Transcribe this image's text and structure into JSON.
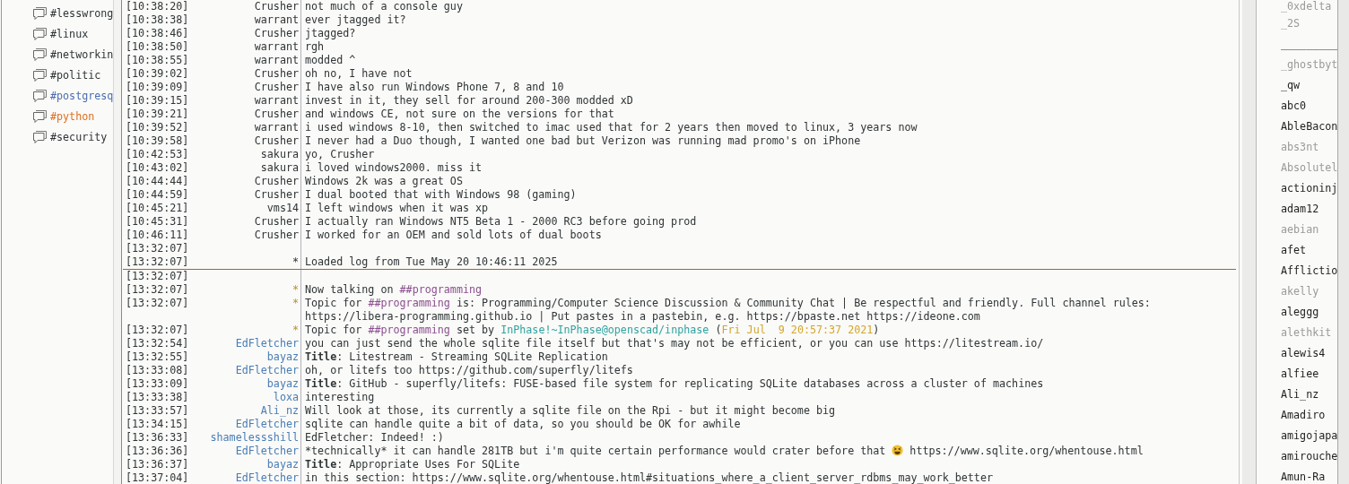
{
  "channels": [
    {
      "name": "#lesswrong",
      "unread": false,
      "highlighted": false
    },
    {
      "name": "#linux",
      "unread": false,
      "highlighted": false
    },
    {
      "name": "#networkin",
      "unread": false,
      "highlighted": false
    },
    {
      "name": "#politic",
      "unread": false,
      "highlighted": false
    },
    {
      "name": "#postgresq",
      "unread": true,
      "highlighted": false
    },
    {
      "name": "#python",
      "unread": false,
      "highlighted": true
    },
    {
      "name": "#security",
      "unread": false,
      "highlighted": false
    }
  ],
  "lines": [
    {
      "kind": "message",
      "time": "[10:38:20]",
      "nick": "Crusher",
      "color": "#2e3436",
      "text": "not much of a console guy"
    },
    {
      "kind": "message",
      "time": "[10:38:38]",
      "nick": "warrant",
      "color": "#2e3436",
      "text": "ever jtagged it?"
    },
    {
      "kind": "message",
      "time": "[10:38:46]",
      "nick": "Crusher",
      "color": "#2e3436",
      "text": "jtagged?"
    },
    {
      "kind": "message",
      "time": "[10:38:50]",
      "nick": "warrant",
      "color": "#2e3436",
      "text": "rgh"
    },
    {
      "kind": "message",
      "time": "[10:38:55]",
      "nick": "warrant",
      "color": "#2e3436",
      "text": "modded ^"
    },
    {
      "kind": "message",
      "time": "[10:39:02]",
      "nick": "Crusher",
      "color": "#2e3436",
      "text": "oh no, I have not"
    },
    {
      "kind": "message",
      "time": "[10:39:09]",
      "nick": "Crusher",
      "color": "#2e3436",
      "text": "I have also run Windows Phone 7, 8 and 10"
    },
    {
      "kind": "message",
      "time": "[10:39:15]",
      "nick": "warrant",
      "color": "#2e3436",
      "text": "invest in it, they sell for around 200-300 modded xD"
    },
    {
      "kind": "message",
      "time": "[10:39:21]",
      "nick": "Crusher",
      "color": "#2e3436",
      "text": "and windows CE, not sure on the versions for that"
    },
    {
      "kind": "message",
      "time": "[10:39:52]",
      "nick": "warrant",
      "color": "#2e3436",
      "text": "i used windows 8-10, then switched to imac used that for 2 years then moved to linux, 3 years now"
    },
    {
      "kind": "message",
      "time": "[10:39:58]",
      "nick": "Crusher",
      "color": "#2e3436",
      "text": "I never had a Duo though, I wanted one bad but Verizon was running mad promo's on iPhone"
    },
    {
      "kind": "message",
      "time": "[10:42:53]",
      "nick": "sakura",
      "color": "#2e3436",
      "text": "yo, Crusher"
    },
    {
      "kind": "message",
      "time": "[10:43:02]",
      "nick": "sakura",
      "color": "#2e3436",
      "text": "i loved windows2000. miss it"
    },
    {
      "kind": "message",
      "time": "[10:44:44]",
      "nick": "Crusher",
      "color": "#2e3436",
      "text": "Windows 2k was a great OS"
    },
    {
      "kind": "message",
      "time": "[10:44:59]",
      "nick": "Crusher",
      "color": "#2e3436",
      "text": "I dual booted that with Windows 98 (gaming)"
    },
    {
      "kind": "message",
      "time": "[10:45:21]",
      "nick": "vms14",
      "color": "#2e3436",
      "text": "I left windows when it was xp"
    },
    {
      "kind": "message",
      "time": "[10:45:31]",
      "nick": "Crusher",
      "color": "#2e3436",
      "text": "I actually ran Windows NT5 Beta 1 - 2000 RC3 before going prod"
    },
    {
      "kind": "message",
      "time": "[10:46:11]",
      "nick": "Crusher",
      "color": "#2e3436",
      "text": "I worked for an OEM and sold lots of dual boots"
    },
    {
      "kind": "message",
      "time": "[13:32:07]"
    },
    {
      "kind": "notice",
      "time": "[13:32:07]",
      "nick": "*",
      "text": "Loaded log from Tue May 20 10:46:11 2025"
    },
    {
      "kind": "marker"
    },
    {
      "kind": "message",
      "time": "[13:32:07]"
    },
    {
      "kind": "event",
      "time": "[13:32:07]",
      "nick": "*",
      "parts": [
        {
          "kind": "plain",
          "text": "Now talking on "
        },
        {
          "kind": "channel",
          "text": "##programming"
        }
      ]
    },
    {
      "kind": "event",
      "time": "[13:32:07]",
      "nick": "*",
      "parts": [
        {
          "kind": "plain",
          "text": "Topic for "
        },
        {
          "kind": "channel",
          "text": "##programming"
        },
        {
          "kind": "plain",
          "text": " is: Programming/Computer Science Discussion & Community Chat | Be respectful and friendly. Full channel rules: https://libera-programming.github.io | Put pastes in a pastebin, e.g. https://bpaste.net https://ideone.com"
        }
      ]
    },
    {
      "kind": "event",
      "time": "[13:32:07]",
      "nick": "*",
      "parts": [
        {
          "kind": "plain",
          "text": "Topic for "
        },
        {
          "kind": "channel",
          "text": "##programming"
        },
        {
          "kind": "plain",
          "text": " set by "
        },
        {
          "kind": "host",
          "text": "InPhase!~InPhase@openscad/inphase"
        },
        {
          "kind": "plain",
          "text": " ("
        },
        {
          "kind": "date",
          "text": "Fri Jul  9 20:57:37 2021"
        },
        {
          "kind": "plain",
          "text": ")"
        }
      ]
    },
    {
      "kind": "message",
      "time": "[13:32:54]",
      "nick": "EdFletcher",
      "color": "#4a7db5",
      "text": "you can just send the whole sqlite file itself but that's may not be efficient, or you can use https://litestream.io/"
    },
    {
      "kind": "message",
      "time": "[13:32:55]",
      "nick": "bayaz",
      "color": "#4a7db5",
      "text": "**Title**: Litestream - Streaming SQLite Replication"
    },
    {
      "kind": "message",
      "time": "[13:33:08]",
      "nick": "EdFletcher",
      "color": "#4a7db5",
      "text": "oh, or litefs too https://github.com/superfly/litefs"
    },
    {
      "kind": "message",
      "time": "[13:33:09]",
      "nick": "bayaz",
      "color": "#4a7db5",
      "text": "**Title**: GitHub - superfly/litefs: FUSE-based file system for replicating SQLite databases across a cluster of machines"
    },
    {
      "kind": "message",
      "time": "[13:33:38]",
      "nick": "loxa",
      "color": "#4a7db5",
      "text": "interesting"
    },
    {
      "kind": "message",
      "time": "[13:33:57]",
      "nick": "Ali_nz",
      "color": "#4a7db5",
      "text": "Will look at those, its currently a sqlite file on the Rpi - but it might become big"
    },
    {
      "kind": "message",
      "time": "[13:34:15]",
      "nick": "EdFletcher",
      "color": "#4a7db5",
      "text": "sqlite can handle quite a bit of data, so you should be OK for awhile"
    },
    {
      "kind": "message",
      "time": "[13:36:33]",
      "nick": "shamelessshill",
      "color": "#4a7db5",
      "text": "EdFletcher: Indeed! :)"
    },
    {
      "kind": "message",
      "time": "[13:36:36]",
      "nick": "EdFletcher",
      "color": "#4a7db5",
      "parts": [
        {
          "kind": "plain",
          "text": "*technically* it can handle 281TB but i'm quite certain performance would crater before that"
        },
        {
          "kind": "emoji"
        },
        {
          "kind": "plain",
          "text": "https://www.sqlite.org/whentouse.html"
        }
      ]
    },
    {
      "kind": "message",
      "time": "[13:36:37]",
      "nick": "bayaz",
      "color": "#4a7db5",
      "text": "**Title**: Appropriate Uses For SQLite"
    },
    {
      "kind": "message",
      "time": "[13:37:04]",
      "nick": "EdFletcher",
      "color": "#4a7db5",
      "text": "in this section: https://www.sqlite.org/whentouse.html#situations_where_a_client_server_rdbms_may_work_better"
    }
  ],
  "users": [
    {
      "nick": "_0xdelta",
      "away": true
    },
    {
      "nick": "_2S",
      "away": true
    },
    {
      "nick": "_________",
      "away": false
    },
    {
      "nick": "_ghostbyt",
      "away": true
    },
    {
      "nick": "_qw",
      "away": false
    },
    {
      "nick": "abc0",
      "away": false
    },
    {
      "nick": "AbleBacon",
      "away": false
    },
    {
      "nick": "abs3nt",
      "away": true
    },
    {
      "nick": "Absolutel",
      "away": true
    },
    {
      "nick": "actioninj",
      "away": false
    },
    {
      "nick": "adam12",
      "away": false
    },
    {
      "nick": "aebian",
      "away": true
    },
    {
      "nick": "afet",
      "away": false
    },
    {
      "nick": "Afflictio",
      "away": false
    },
    {
      "nick": "akelly",
      "away": true
    },
    {
      "nick": "aleggg",
      "away": false
    },
    {
      "nick": "alethkit",
      "away": true
    },
    {
      "nick": "alewis4",
      "away": false
    },
    {
      "nick": "alfiee",
      "away": false
    },
    {
      "nick": "Ali_nz",
      "away": false
    },
    {
      "nick": "Amadiro",
      "away": false
    },
    {
      "nick": "amigojapa",
      "away": false
    },
    {
      "nick": "amirouche",
      "away": false
    },
    {
      "nick": "Amun-Ra",
      "away": false
    }
  ]
}
